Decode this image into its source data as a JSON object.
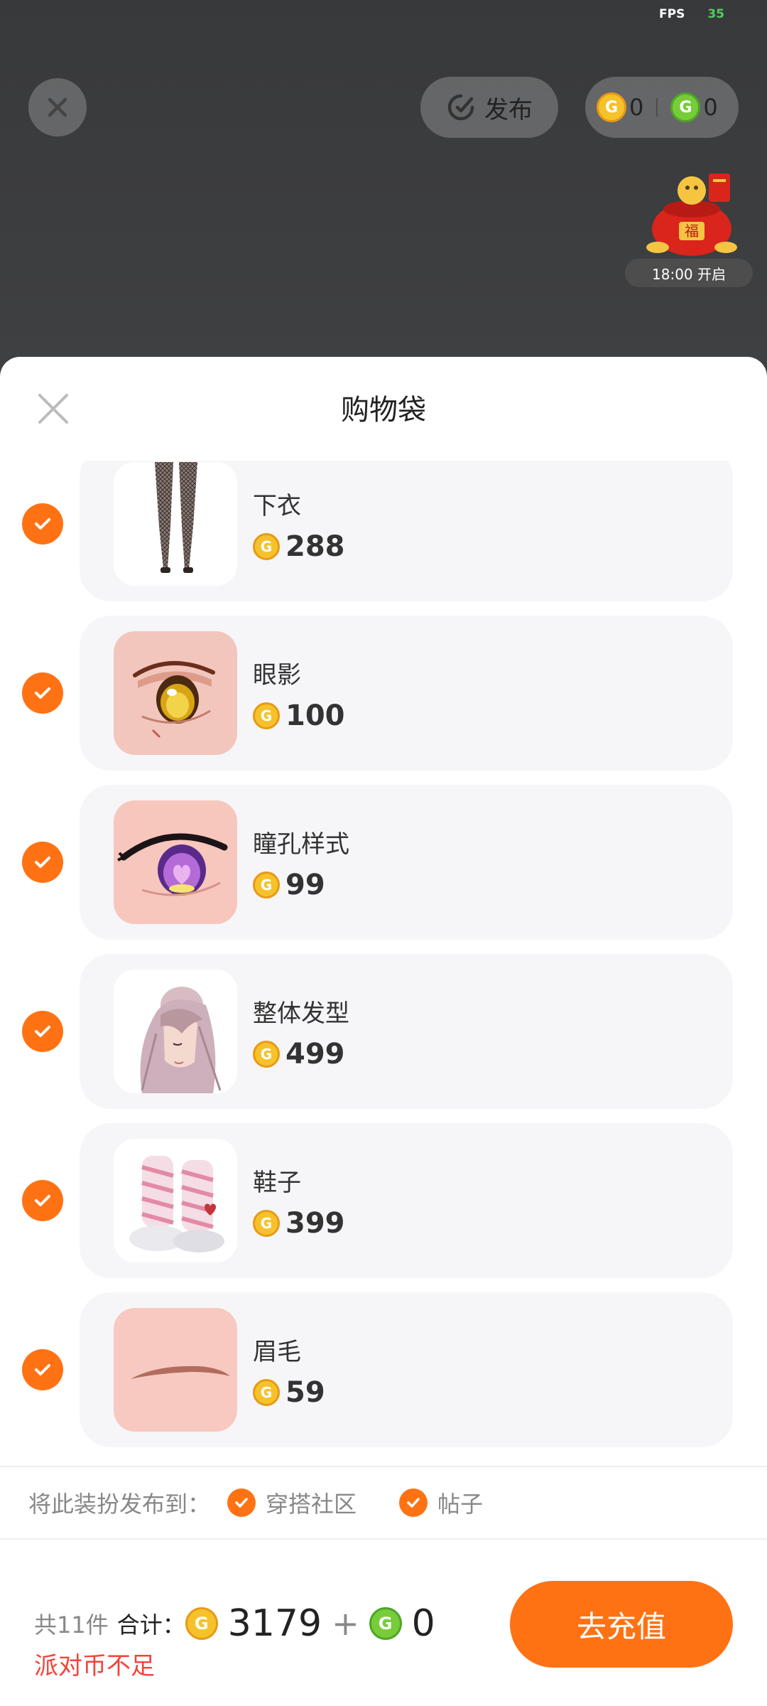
{
  "status": {
    "fps_label": "FPS",
    "fps_value": "35"
  },
  "top_bar": {
    "publish_label": "发布",
    "gold_balance": "0",
    "green_balance": "0",
    "event_time": "18:00 开启"
  },
  "sheet": {
    "title": "购物袋",
    "items": [
      {
        "name": "下衣",
        "price": "288",
        "thumb_icon": "stockings-icon"
      },
      {
        "name": "眼影",
        "price": "100",
        "thumb_icon": "eyeshadow-icon"
      },
      {
        "name": "瞳孔样式",
        "price": "99",
        "thumb_icon": "pupil-icon"
      },
      {
        "name": "整体发型",
        "price": "499",
        "thumb_icon": "hairstyle-icon"
      },
      {
        "name": "鞋子",
        "price": "399",
        "thumb_icon": "shoes-icon"
      },
      {
        "name": "眉毛",
        "price": "59",
        "thumb_icon": "eyebrow-icon"
      }
    ]
  },
  "publish": {
    "label": "将此装扮发布到：",
    "options": [
      {
        "label": "穿搭社区"
      },
      {
        "label": "帖子"
      }
    ]
  },
  "footer": {
    "count_label": "共11件",
    "total_label": "合计：",
    "gold_total": "3179",
    "plus": "+",
    "green_total": "0",
    "warning": "派对币不足",
    "recharge_label": "去充值"
  },
  "colors": {
    "accent": "#ff7214",
    "warning": "#f2443b",
    "gold_coin": "#f6c22b",
    "green_coin": "#77cc3a"
  }
}
